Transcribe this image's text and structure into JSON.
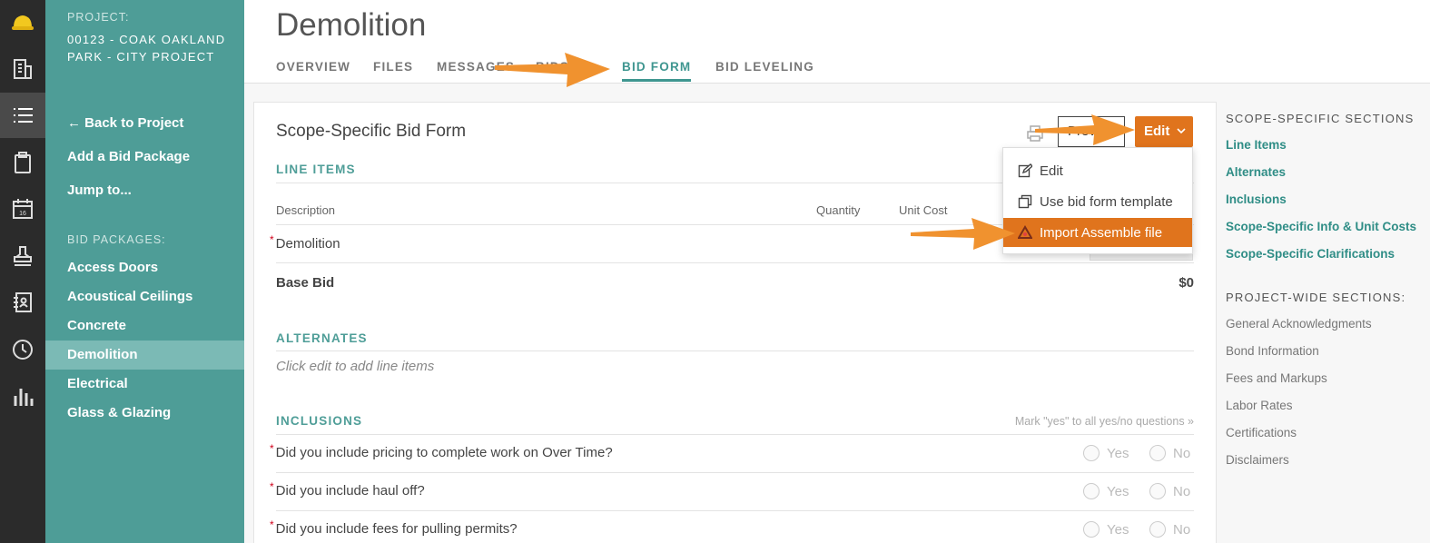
{
  "rail": {
    "items": [
      {
        "icon": "hardhat-logo-icon",
        "active": false
      },
      {
        "icon": "building-icon",
        "active": false
      },
      {
        "icon": "list-icon",
        "active": true
      },
      {
        "icon": "clipboard-icon",
        "active": false
      },
      {
        "icon": "calendar-icon",
        "active": false
      },
      {
        "icon": "stamp-icon",
        "active": false
      },
      {
        "icon": "address-book-icon",
        "active": false
      },
      {
        "icon": "clock-icon",
        "active": false
      },
      {
        "icon": "bar-chart-icon",
        "active": false
      }
    ],
    "calendar_day": "16"
  },
  "project": {
    "label": "PROJECT:",
    "name": "00123 - COAK OAKLAND PARK - CITY PROJECT"
  },
  "sidebar": {
    "back_label": "← Back to Project",
    "add_package": "Add a Bid Package",
    "jump_to": "Jump to...",
    "packages_label": "BID PACKAGES:",
    "packages": [
      "Access Doors",
      "Acoustical Ceilings",
      "Concrete",
      "Demolition",
      "Electrical",
      "Glass & Glazing"
    ],
    "active_package": "Demolition"
  },
  "header": {
    "title": "Demolition",
    "tabs": [
      "OVERVIEW",
      "FILES",
      "MESSAGES",
      "BIDS",
      "BID FORM",
      "BID LEVELING"
    ],
    "active_tab": "BID FORM"
  },
  "form": {
    "title": "Scope-Specific Bid Form",
    "preview_label": "Preview",
    "edit_label": "Edit",
    "line_items_heading": "LINE ITEMS",
    "columns": {
      "description": "Description",
      "quantity": "Quantity",
      "unit_cost": "Unit Cost"
    },
    "line_items": [
      {
        "description": "Demolition",
        "required": true
      }
    ],
    "base_bid_label": "Base Bid",
    "base_bid_value": "$0",
    "alternates_heading": "ALTERNATES",
    "alternates_empty": "Click edit to add line items",
    "inclusions_heading": "INCLUSIONS",
    "mark_all_yes": "Mark \"yes\" to all yes/no questions »",
    "yes_label": "Yes",
    "no_label": "No",
    "questions": [
      "Did you include pricing to complete work on Over Time?",
      "Did you include haul off?",
      "Did you include fees for pulling permits?"
    ]
  },
  "edit_menu": {
    "items": [
      {
        "label": "Edit",
        "icon": "pencil-icon",
        "active": false
      },
      {
        "label": "Use bid form template",
        "icon": "copy-icon",
        "active": false
      },
      {
        "label": "Import Assemble file",
        "icon": "assemble-logo-icon",
        "active": true
      }
    ]
  },
  "right_nav": {
    "scope_heading": "SCOPE-SPECIFIC SECTIONS",
    "scope_links": [
      "Line Items",
      "Alternates",
      "Inclusions",
      "Scope-Specific Info & Unit Costs",
      "Scope-Specific Clarifications"
    ],
    "project_heading": "PROJECT-WIDE SECTIONS:",
    "project_links": [
      "General Acknowledgments",
      "Bond Information",
      "Fees and Markups",
      "Labor Rates",
      "Certifications",
      "Disclaimers"
    ]
  },
  "colors": {
    "accent_orange": "#e0741d",
    "annotation_arrow": "#f0922f",
    "teal": "#4e9d97",
    "rail": "#2b2b2b"
  }
}
